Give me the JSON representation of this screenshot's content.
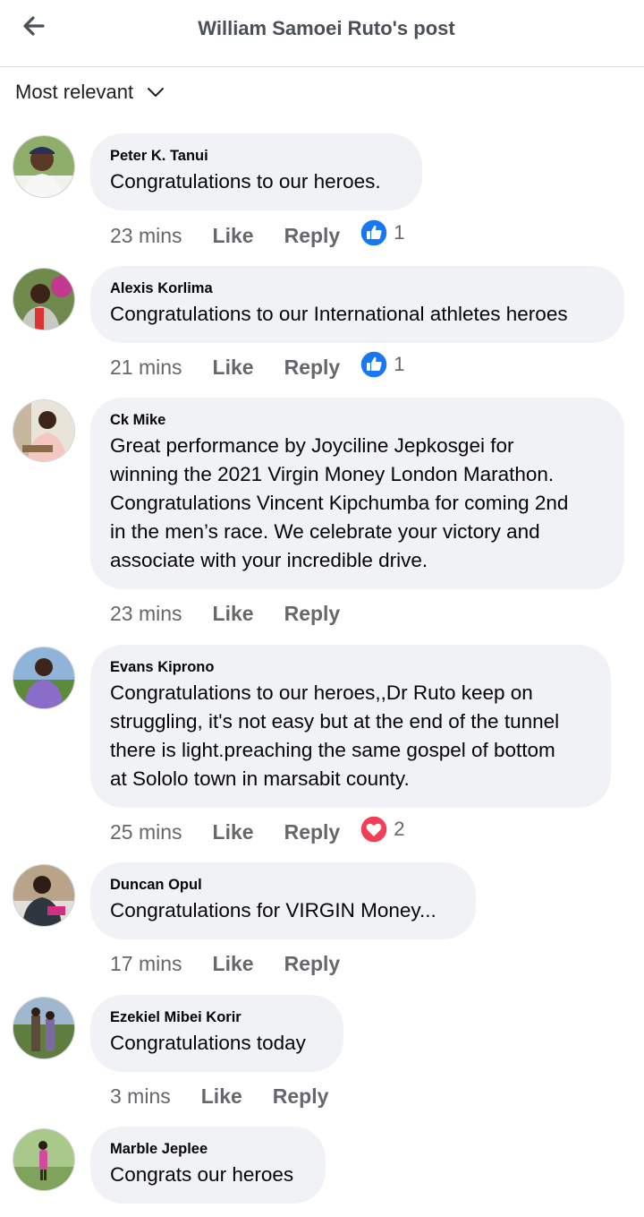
{
  "header": {
    "title": "William Samoei Ruto's post",
    "back_icon": "arrow-left-icon"
  },
  "sort": {
    "label": "Most relevant",
    "icon": "chevron-down-icon"
  },
  "colors": {
    "like_blue": "#1877f2",
    "love_red": "#f33e58",
    "bubble_bg": "#f0f2f5",
    "meta_gray": "#65676b"
  },
  "comments": [
    {
      "author": "Peter K. Tanui",
      "text": "Congratulations to our heroes.",
      "time": "23 mins",
      "like": "Like",
      "reply": "Reply",
      "reaction": "like",
      "count": "1"
    },
    {
      "author": "Alexis Korlima",
      "text": "Congratulations to our International athletes heroes",
      "time": "21 mins",
      "like": "Like",
      "reply": "Reply",
      "reaction": "like",
      "count": "1"
    },
    {
      "author": "Ck Mike",
      "text": "Great performance by Joyciline Jepkosgei for\nwinning the 2021 Virgin Money London Marathon.\nCongratulations Vincent Kipchumba for coming 2nd\nin the men’s race. We celebrate your victory and\nassociate with your incredible drive.",
      "time": "23 mins",
      "like": "Like",
      "reply": "Reply"
    },
    {
      "author": "Evans Kiprono",
      "text": "Congratulations to our heroes,,Dr Ruto keep on\nstruggling, it's not easy but at the end of the tunnel\nthere is light.preaching the same gospel of bottom\nat Sololo town in marsabit county.",
      "time": "25 mins",
      "like": "Like",
      "reply": "Reply",
      "reaction": "love",
      "count": "2"
    },
    {
      "author": "Duncan Opul",
      "text": "Congratulations for VIRGIN Money...",
      "time": "17 mins",
      "like": "Like",
      "reply": "Reply"
    },
    {
      "author": "Ezekiel Mibei Korir",
      "text": "Congratulations today",
      "time": "3 mins",
      "like": "Like",
      "reply": "Reply"
    },
    {
      "author": "Marble Jeplee",
      "text": "Congrats our heroes"
    }
  ]
}
